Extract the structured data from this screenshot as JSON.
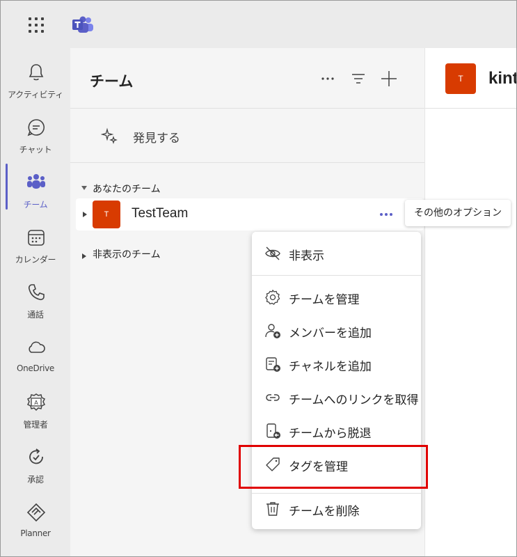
{
  "colors": {
    "accent": "#5b5fc7",
    "avatar": "#d83b01",
    "highlight": "#e00000"
  },
  "rail": {
    "items": [
      {
        "label": "アクティビティ",
        "icon": "bell-icon"
      },
      {
        "label": "チャット",
        "icon": "chat-icon"
      },
      {
        "label": "チーム",
        "icon": "teams-icon",
        "active": true
      },
      {
        "label": "カレンダー",
        "icon": "calendar-icon"
      },
      {
        "label": "通話",
        "icon": "phone-icon"
      },
      {
        "label": "OneDrive",
        "icon": "cloud-icon"
      },
      {
        "label": "管理者",
        "icon": "admin-icon"
      },
      {
        "label": "承認",
        "icon": "approvals-icon"
      },
      {
        "label": "Planner",
        "icon": "planner-icon"
      }
    ]
  },
  "panel": {
    "title": "チーム",
    "discover_label": "発見する",
    "your_teams_label": "あなたのチーム",
    "hidden_teams_label": "非表示のチーム",
    "team": {
      "name": "TestTeam",
      "initial": "T"
    }
  },
  "tooltip": {
    "text": "その他のオプション"
  },
  "chat": {
    "initial": "T",
    "title": "kint"
  },
  "menu": {
    "items": [
      {
        "label": "非表示",
        "icon": "eye-off-icon"
      },
      {
        "label": "チームを管理",
        "icon": "gear-icon"
      },
      {
        "label": "メンバーを追加",
        "icon": "person-add-icon"
      },
      {
        "label": "チャネルを追加",
        "icon": "channel-add-icon"
      },
      {
        "label": "チームへのリンクを取得",
        "icon": "link-icon"
      },
      {
        "label": "チームから脱退",
        "icon": "leave-icon"
      },
      {
        "label": "タグを管理",
        "icon": "tag-icon"
      },
      {
        "label": "チームを削除",
        "icon": "trash-icon"
      }
    ]
  }
}
